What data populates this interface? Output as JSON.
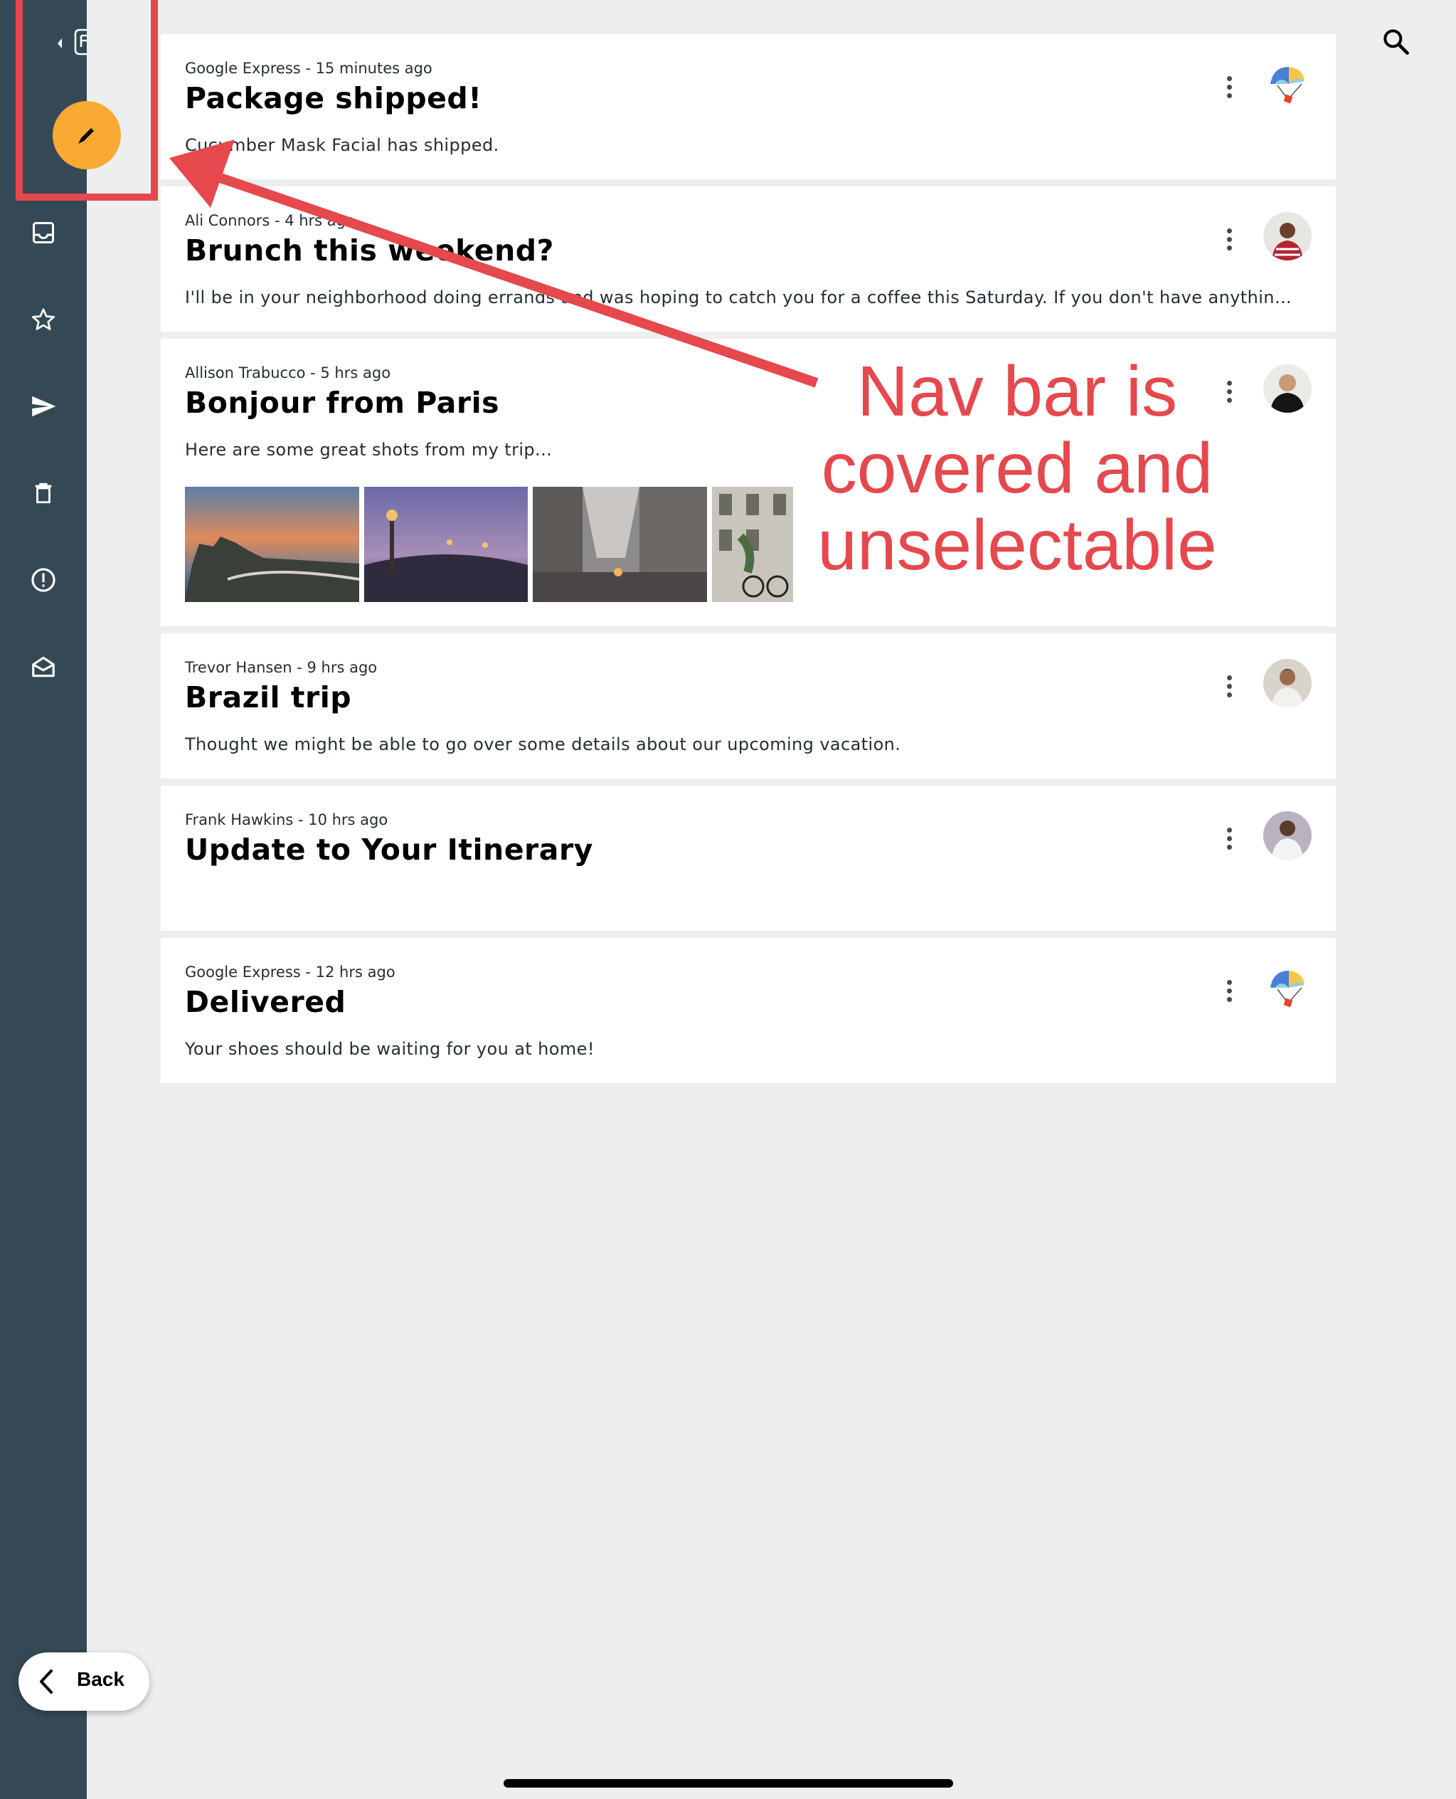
{
  "colors": {
    "rail": "#344955",
    "fab": "#f9aa33",
    "background": "#edeef0",
    "annotation": "#e5484d"
  },
  "rail": {
    "items": [
      {
        "name": "inbox",
        "icon": "inbox-icon"
      },
      {
        "name": "starred",
        "icon": "star-icon"
      },
      {
        "name": "sent",
        "icon": "send-icon"
      },
      {
        "name": "trash",
        "icon": "trash-icon"
      },
      {
        "name": "spam",
        "icon": "alert-icon"
      },
      {
        "name": "drafts",
        "icon": "drafts-icon"
      }
    ],
    "fab_icon": "pencil-icon"
  },
  "emails": [
    {
      "meta": "Google Express - 15 minutes ago",
      "subject": "Package shipped!",
      "preview": "Cucumber Mask Facial has shipped.",
      "avatar": "google-express-avatar"
    },
    {
      "meta": "Ali Connors - 4 hrs ago",
      "subject": "Brunch this weekend?",
      "preview": "I'll be in your neighborhood doing errands and was hoping to catch you for a coffee this Saturday. If you don't have anything sche...",
      "avatar": "person-avatar"
    },
    {
      "meta": "Allison Trabucco - 5 hrs ago",
      "subject": "Bonjour from Paris",
      "preview": "Here are some great shots from my trip...",
      "avatar": "person-avatar"
    },
    {
      "meta": "Trevor Hansen - 9 hrs ago",
      "subject": "Brazil trip",
      "preview": "Thought we might be able to go over some details about our upcoming vacation.",
      "avatar": "person-avatar"
    },
    {
      "meta": "Frank Hawkins - 10 hrs ago",
      "subject": "Update to Your Itinerary",
      "preview": "",
      "avatar": "person-avatar"
    },
    {
      "meta": "Google Express - 12 hrs ago",
      "subject": "Delivered",
      "preview": "Your shoes should be waiting for you at home!",
      "avatar": "google-express-avatar"
    }
  ],
  "annotation": {
    "text": "Nav bar is covered and unselectable"
  },
  "back_button": {
    "label": "Back"
  }
}
